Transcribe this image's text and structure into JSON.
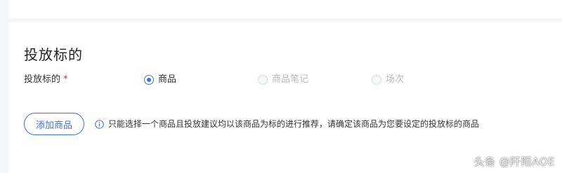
{
  "section": {
    "title": "投放标的"
  },
  "target_field": {
    "label": "投放标的",
    "required_mark": "*",
    "options": [
      {
        "label": "商品",
        "state": "checked"
      },
      {
        "label": "商品笔记",
        "state": "disabled"
      },
      {
        "label": "场次",
        "state": "disabled"
      }
    ]
  },
  "actions": {
    "add_product_label": "添加商品"
  },
  "hint": {
    "icon": "info-icon",
    "text": "只能选择一个商品且投放建议均以该商品为标的进行推荐，请确定该商品为您要设定的投放标的商品"
  },
  "watermark": {
    "text": "头条 @阡陌AOE"
  },
  "colors": {
    "accent": "#3a6ff7",
    "required": "#f5222d",
    "disabled_text": "#b7bbc2"
  }
}
